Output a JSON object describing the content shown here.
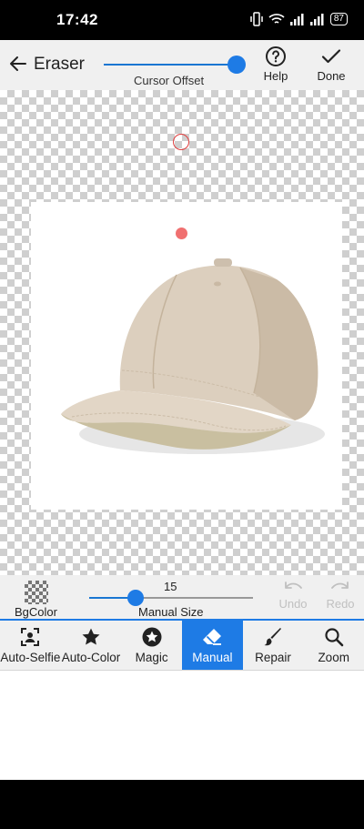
{
  "status_bar": {
    "time": "17:42",
    "battery": "87"
  },
  "top_bar": {
    "title": "Eraser",
    "slider_label": "Cursor Offset",
    "help_label": "Help",
    "done_label": "Done"
  },
  "controls": {
    "bgcolor_label": "BgColor",
    "size_value": "15",
    "size_label": "Manual Size",
    "undo_label": "Undo",
    "redo_label": "Redo"
  },
  "tools": [
    {
      "label": "Auto-Selfie",
      "icon": "portrait-icon"
    },
    {
      "label": "Auto-Color",
      "icon": "star-icon"
    },
    {
      "label": "Magic",
      "icon": "magic-star-icon"
    },
    {
      "label": "Manual",
      "icon": "eraser-icon",
      "active": true
    },
    {
      "label": "Repair",
      "icon": "brush-icon"
    },
    {
      "label": "Zoom",
      "icon": "search-icon"
    }
  ],
  "colors": {
    "accent": "#1e7be5",
    "toolbar_bg": "#f0f0f0"
  }
}
